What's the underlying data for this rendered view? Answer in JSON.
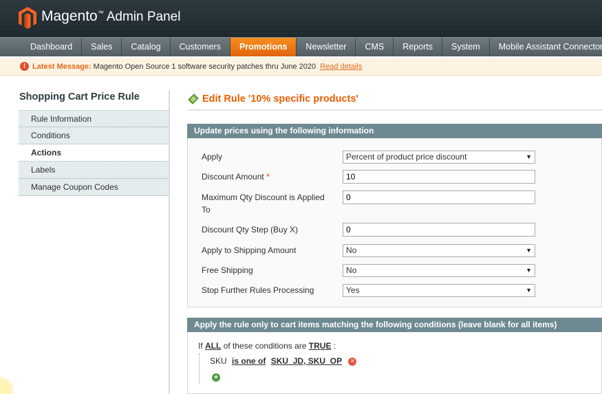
{
  "header": {
    "brand": "Magento",
    "trademark": "™",
    "subtitle": "Admin Panel"
  },
  "nav": [
    "Dashboard",
    "Sales",
    "Catalog",
    "Customers",
    "Promotions",
    "Newsletter",
    "CMS",
    "Reports",
    "System",
    "Mobile Assistant Connector"
  ],
  "nav_active": "Promotions",
  "message": {
    "label": "Latest Message:",
    "text": "Magento Open Source 1 software security patches thru June 2020",
    "link": "Read details"
  },
  "sidebar": {
    "title": "Shopping Cart Price Rule",
    "tabs": [
      "Rule Information",
      "Conditions",
      "Actions",
      "Labels",
      "Manage Coupon Codes"
    ],
    "active": "Actions"
  },
  "page": {
    "title": "Edit Rule '10% specific products'"
  },
  "actions_box": {
    "title": "Update prices using the following information",
    "apply_label": "Apply",
    "apply_value": "Percent of product price discount",
    "discount_amount_label": "Discount Amount",
    "discount_amount_required": "*",
    "discount_amount_value": "10",
    "max_qty_label_line1": "Maximum Qty Discount is Applied",
    "max_qty_label_line2": "To",
    "max_qty_value": "0",
    "qty_step_label": "Discount Qty Step (Buy X)",
    "qty_step_value": "0",
    "apply_shipping_label": "Apply to Shipping Amount",
    "apply_shipping_value": "No",
    "free_shipping_label": "Free Shipping",
    "free_shipping_value": "No",
    "stop_rules_label": "Stop Further Rules Processing",
    "stop_rules_value": "Yes"
  },
  "conditions_box": {
    "title": "Apply the rule only to cart items matching the following conditions (leave blank for all items)",
    "if_text": "If",
    "aggregator": "ALL",
    "middle_text": "of these conditions are",
    "value": "TRUE",
    "colon": ":",
    "rule_attribute": "SKU",
    "rule_operator": "is one of",
    "rule_value": "SKU_JD, SKU_OP"
  },
  "icons": {
    "logo": "magento-logo-icon",
    "message": "alert-icon",
    "edit": "edit-rule-icon",
    "remove": "remove-condition-icon",
    "add": "add-condition-icon"
  },
  "colors": {
    "accent": "#eb5e00",
    "nav_active": "#f08218",
    "header": "#2d3a40",
    "box_header": "#6f8992"
  }
}
